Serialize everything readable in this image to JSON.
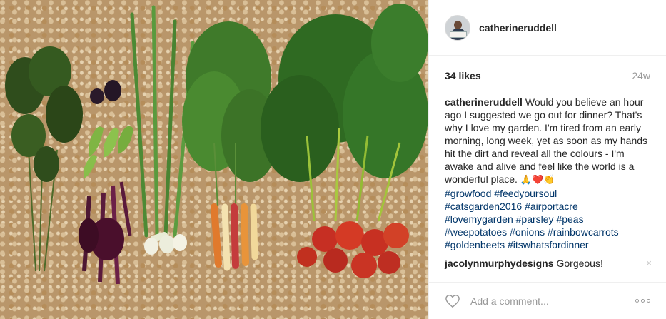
{
  "post": {
    "username": "catherineruddell",
    "likes": "34 likes",
    "time_ago": "24w",
    "caption": {
      "user": "catherineruddell",
      "text": "Would you believe an hour ago I suggested we go out for dinner? That's why I love my garden. I'm tired from an early morning, long week, yet as soon as my hands hit the dirt and reveal all the colours - I'm awake and alive and feel like the world is a wonderful place.",
      "emojis": [
        "🙏",
        "❤️",
        "👏"
      ],
      "hashtags": [
        "#growfood",
        "#feedyoursoul",
        "#catsgarden2016",
        "#airportacre",
        "#lovemygarden",
        "#parsley",
        "#peas",
        "#weepotatoes",
        "#onions",
        "#rainbowcarrots",
        "#goldenbeets",
        "#itswhatsfordinner"
      ]
    },
    "comments": [
      {
        "user": "jacolynmurphydesigns",
        "text": "Gorgeous!",
        "delete_icon": "×"
      }
    ],
    "add_comment_placeholder": "Add a comment...",
    "icons": {
      "like": "heart-outline-icon",
      "more": "more-options-icon",
      "avatar": "avatar"
    }
  },
  "colors": {
    "text": "#262626",
    "muted": "#999999",
    "hashtag": "#003569",
    "border": "#efefef"
  }
}
